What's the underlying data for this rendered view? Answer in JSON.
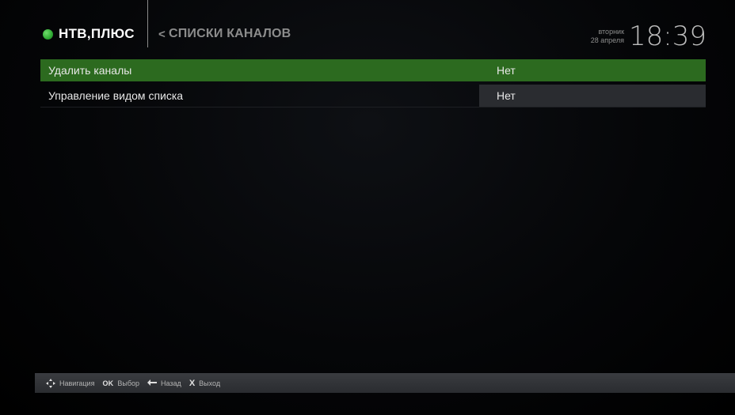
{
  "header": {
    "logo_text": "НТВ,ПЛЮС",
    "breadcrumb": "СПИСКИ КАНАЛОВ",
    "breadcrumb_arrow": "<",
    "weekday": "вторник",
    "date": "28 апреля",
    "time": "18:39"
  },
  "menu": {
    "items": [
      {
        "label": "Удалить каналы",
        "value": "Нет",
        "selected": true
      },
      {
        "label": "Управление видом списка",
        "value": "Нет",
        "selected": false
      }
    ]
  },
  "helpbar": {
    "items": [
      {
        "icon": "dpad-icon",
        "key": "",
        "label": "Навигация"
      },
      {
        "icon": "ok-key-icon",
        "key": "OK",
        "label": "Выбор"
      },
      {
        "icon": "back-arrow-icon",
        "key": "↩",
        "label": "Назад"
      },
      {
        "icon": "close-icon",
        "key": "X",
        "label": "Выход"
      }
    ]
  },
  "colors": {
    "selected_row": "#2c6a1f",
    "logo_dot": "#2faa33",
    "value_box": "#2a2c30"
  }
}
